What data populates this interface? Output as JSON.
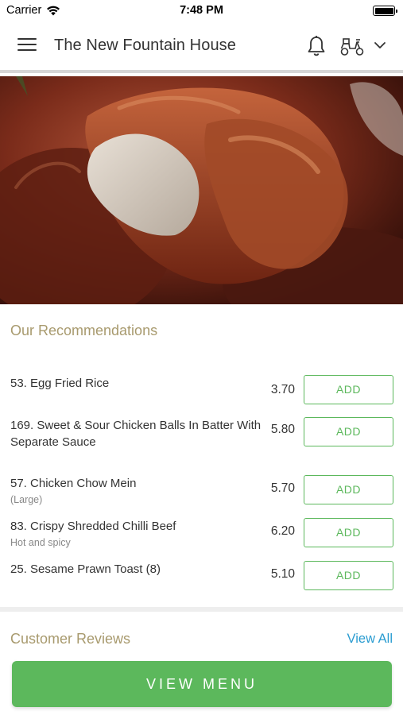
{
  "status_bar": {
    "carrier": "Carrier",
    "time": "7:48 PM"
  },
  "header": {
    "title": "The New Fountain House",
    "icons": [
      "menu-icon",
      "bell-icon",
      "scooter-icon",
      "chevron-down-icon"
    ]
  },
  "recommendations": {
    "title": "Our Recommendations",
    "add_label": "ADD",
    "items": [
      {
        "name": "53. Egg Fried Rice",
        "sub": "",
        "price": "3.70"
      },
      {
        "name": "169. Sweet & Sour Chicken Balls In Batter With Separate Sauce",
        "sub": "",
        "price": "5.80"
      },
      {
        "name": "57. Chicken Chow Mein",
        "sub": "(Large)",
        "price": "5.70"
      },
      {
        "name": "83. Crispy Shredded Chilli Beef",
        "sub": "Hot and spicy",
        "price": "6.20"
      },
      {
        "name": "25. Sesame Prawn Toast (8)",
        "sub": "",
        "price": "5.10"
      }
    ]
  },
  "reviews": {
    "title": "Customer Reviews",
    "view_all": "View All"
  },
  "footer": {
    "view_menu": "VIEW MENU"
  },
  "colors": {
    "accent_green": "#5cb85c",
    "section_title": "#a89a6e",
    "link_blue": "#2a9cd1"
  }
}
